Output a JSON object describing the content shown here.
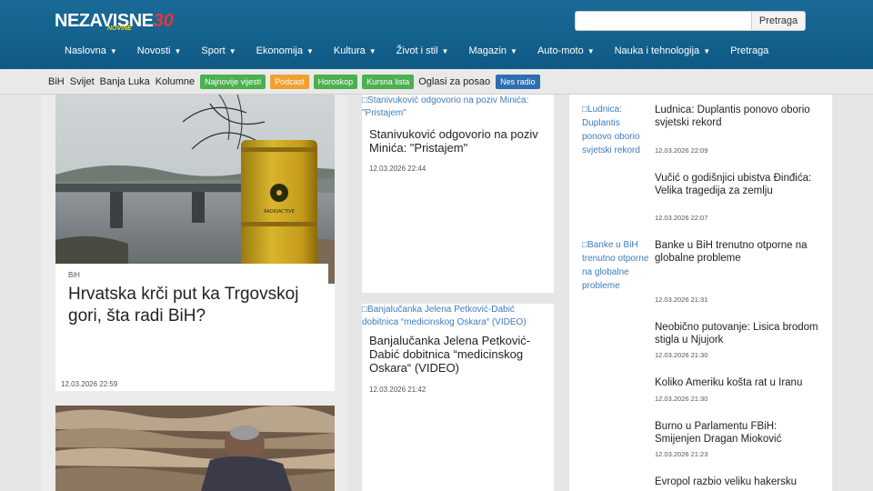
{
  "header": {
    "logo_text": "NEZAVISNE",
    "logo_number": "30",
    "logo_sub": "NOVINE",
    "search_placeholder": "",
    "search_button": "Pretraga"
  },
  "nav": [
    {
      "label": "Naslovna",
      "caret": true
    },
    {
      "label": "Novosti",
      "caret": true
    },
    {
      "label": "Sport",
      "caret": true
    },
    {
      "label": "Ekonomija",
      "caret": true
    },
    {
      "label": "Kultura",
      "caret": true
    },
    {
      "label": "Život i stil",
      "caret": true
    },
    {
      "label": "Magazin",
      "caret": true
    },
    {
      "label": "Auto-moto",
      "caret": true
    },
    {
      "label": "Nauka i tehnologija",
      "caret": true
    },
    {
      "label": "Pretraga",
      "caret": false
    }
  ],
  "subnav": {
    "links": [
      "BiH",
      "Svijet",
      "Banja Luka",
      "Kolumne"
    ],
    "badges": [
      {
        "label": "Najnovije vijesti",
        "color": "#4caf50"
      },
      {
        "label": "Podcast",
        "color": "#f0a030"
      },
      {
        "label": "Horoskop",
        "color": "#4caf50"
      },
      {
        "label": "Kursna lista",
        "color": "#4caf50"
      }
    ],
    "plain": "Oglasi za posao",
    "radio": {
      "label": "Nes radio",
      "color": "#2f6db0"
    }
  },
  "main_story": {
    "kicker": "BiH",
    "title": "Hrvatska krči put ka Trgovskoj gori, šta radi BiH?",
    "time": "12.03.2026 22:59",
    "barrel_label": "RADIOACTIVE"
  },
  "mid_stories": [
    {
      "img_alt": "Stanivuković odgovorio na poziv Minića: \"Pristajem\"",
      "title": "Stanivuković odgovorio na poziv Minića: \"Pristajem\"",
      "time": "12.03.2026 22:44"
    },
    {
      "img_alt": "Banjalučanka Jelena Petković-Dabić dobitnica “medicinskog Oskara“ (VIDEO)",
      "title": "Banjalučanka Jelena Petković-Dabić dobitnica “medicinskog Oskara“ (VIDEO)",
      "time": "12.03.2026 21:42"
    }
  ],
  "right_stories": [
    {
      "img_alt": "Ludnica: Duplantis ponovo oborio svjetski rekord",
      "title": "Ludnica: Duplantis ponovo oborio svjetski rekord",
      "time": "12.03.2026 22:09"
    },
    {
      "img_alt": "",
      "title": "Vučić o godišnjici ubistva Đinđića: Velika tragedija za zemlju",
      "time": "12.03.2026 22:07"
    },
    {
      "img_alt": "Banke u BiH trenutno otporne na globalne probleme",
      "title": "Banke u BiH trenutno otporne na globalne probleme",
      "time": "12.03.2026 21:31"
    },
    {
      "img_alt": "",
      "title": "Neobično putovanje: Lisica brodom stigla u Njujork",
      "time": "12.03.2026 21:30"
    },
    {
      "img_alt": "",
      "title": "Koliko Ameriku košta rat u Iranu",
      "time": "12.03.2026 21:30"
    },
    {
      "img_alt": "",
      "title": "Burno u Parlamentu FBiH: Smijenjen Dragan Mioković",
      "time": "12.03.2026 21:23"
    },
    {
      "img_alt": "",
      "title": "Evropol razbio veliku hakersku",
      "time": ""
    }
  ]
}
